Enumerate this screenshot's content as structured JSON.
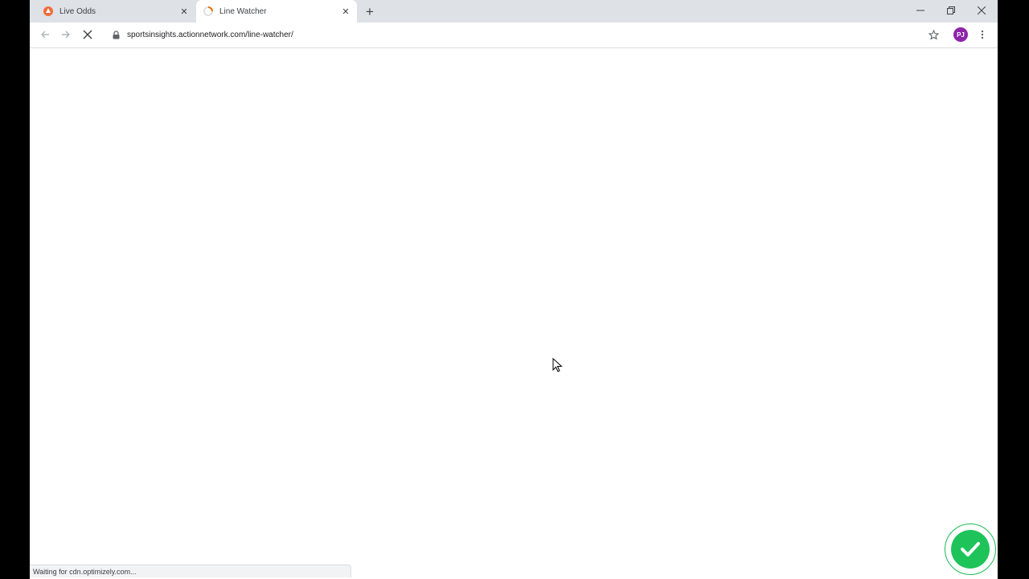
{
  "tabs": [
    {
      "title": "Live Odds",
      "icon": "action-network-favicon",
      "active": false
    },
    {
      "title": "Line Watcher",
      "icon": "loading-favicon",
      "active": true
    }
  ],
  "toolbar": {
    "url": "sportsinsights.actionnetwork.com/line-watcher/",
    "profile_initials": "PJ"
  },
  "status_bar": {
    "text": "Waiting for cdn.optimizely.com..."
  },
  "colors": {
    "tabstrip_bg": "#dee1e6",
    "avatar_bg": "#8e24aa",
    "check_green": "#1ec45a"
  }
}
